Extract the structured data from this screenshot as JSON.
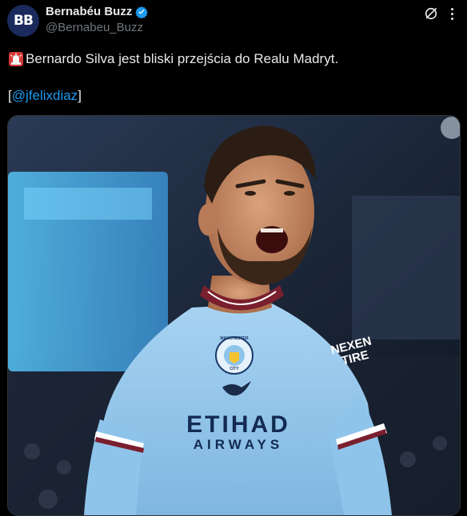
{
  "author": {
    "display_name": "Bernabéu Buzz",
    "handle": "@Bernabeu_Buzz",
    "avatar_initials": "BB",
    "verified": true
  },
  "tweet": {
    "text": "Bernardo Silva jest bliski przejścia do Realu Madryt.",
    "mention_open": "[",
    "mention": "@jfelixdiaz",
    "mention_close": "]",
    "emoji": "siren-emoji"
  },
  "media": {
    "kit_sponsor": "ETIHAD",
    "kit_sponsor_sub": "AIRWAYS",
    "sleeve_sponsor_line1": "NEXEN",
    "sleeve_sponsor_line2": "TIRE",
    "crest_text_top": "MANCHESTER",
    "crest_text_bottom": "CITY"
  },
  "colors": {
    "background": "#000000",
    "text": "#e7e9ea",
    "muted": "#71767b",
    "link": "#1d9bf0",
    "verified": "#1d9bf0",
    "kit": "#98c5e9",
    "collar": "#7a1f2e"
  }
}
